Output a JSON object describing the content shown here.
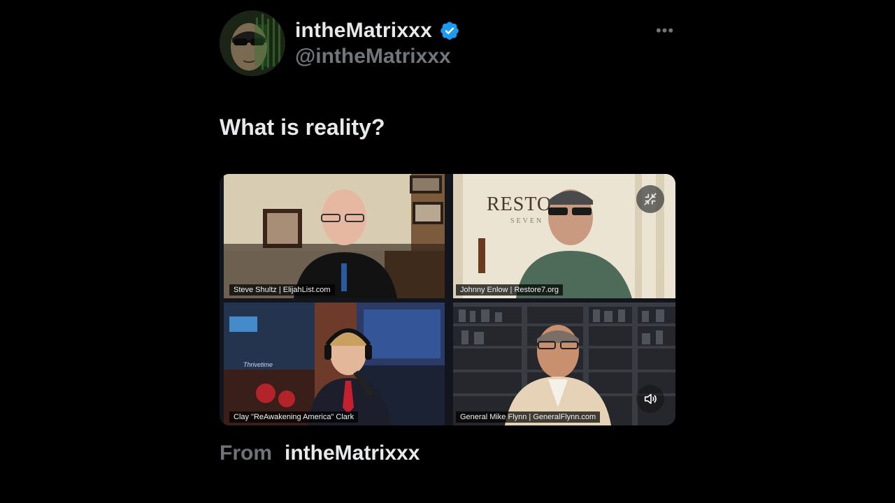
{
  "author": {
    "display_name": "intheMatrixxx",
    "handle": "@intheMatrixxx",
    "verified": true,
    "avatar_icon": "avatar-photo"
  },
  "header": {
    "more_icon": "more-options-icon",
    "more_label": "•••"
  },
  "tweet": {
    "text": "What is reality?"
  },
  "video": {
    "speakers": [
      {
        "label": "Steve Shultz | ElijahList.com"
      },
      {
        "label": "Johnny Enlow | Restore7.org",
        "backdrop_text": "RESTOR",
        "backdrop_sub": "SEVEN"
      },
      {
        "label": "Clay \"ReAwakening America\" Clark"
      },
      {
        "label": "General Mike Flynn | GeneralFlynn.com"
      }
    ],
    "controls": {
      "fullscreen_icon": "fullscreen-exit-icon",
      "sound_icon": "speaker-icon"
    }
  },
  "footer": {
    "from_label": "From",
    "from_name": "intheMatrixxx"
  },
  "colors": {
    "background": "#000000",
    "text_primary": "#e7e9ea",
    "text_secondary": "#71767b",
    "verified_blue": "#1d9bf0"
  }
}
